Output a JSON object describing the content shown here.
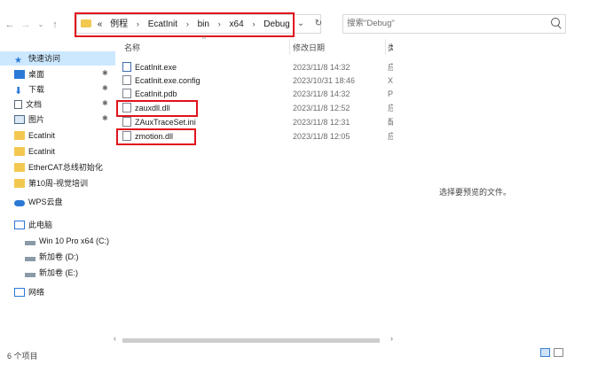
{
  "address": {
    "overflow": "«",
    "crumbs": [
      "例程",
      "EcatInit",
      "bin",
      "x64",
      "Debug"
    ]
  },
  "search": {
    "placeholder": "搜索\"Debug\""
  },
  "sidebar": {
    "quick_access": "快速访问",
    "pinned": [
      {
        "label": "桌面",
        "icon": "desktop-icon"
      },
      {
        "label": "下载",
        "icon": "download-icon"
      },
      {
        "label": "文档",
        "icon": "document-icon"
      },
      {
        "label": "图片",
        "icon": "picture-icon"
      }
    ],
    "folders": [
      "EcatInit",
      "EcatInit",
      "EtherCAT总线初始化",
      "第10周-视觉培训"
    ],
    "wps": "WPS云盘",
    "this_pc": "此电脑",
    "drives": [
      "Win 10 Pro x64 (C:)",
      "新加卷 (D:)",
      "新加卷 (E:)"
    ],
    "network": "网络"
  },
  "columns": {
    "name": "名称",
    "date": "修改日期",
    "type_partial": "类"
  },
  "files": [
    {
      "name": "EcatInit.exe",
      "date": "2023/11/8 14:32",
      "trunc": "应"
    },
    {
      "name": "EcatInit.exe.config",
      "date": "2023/10/31 18:46",
      "trunc": "X"
    },
    {
      "name": "EcatInit.pdb",
      "date": "2023/11/8 14:32",
      "trunc": "P"
    },
    {
      "name": "zauxdll.dll",
      "date": "2023/11/8 12:52",
      "trunc": "应"
    },
    {
      "name": "ZAuxTraceSet.ini",
      "date": "2023/11/8 12:31",
      "trunc": "配"
    },
    {
      "name": "zmotion.dll",
      "date": "2023/11/8 12:05",
      "trunc": "应"
    }
  ],
  "preview_message": "选择要预览的文件。",
  "status": {
    "item_count": "6 个项目"
  },
  "colors": {
    "highlight_box": "#e0121c",
    "quick_access_bg": "#cce8ff",
    "folder": "#f3c851"
  }
}
